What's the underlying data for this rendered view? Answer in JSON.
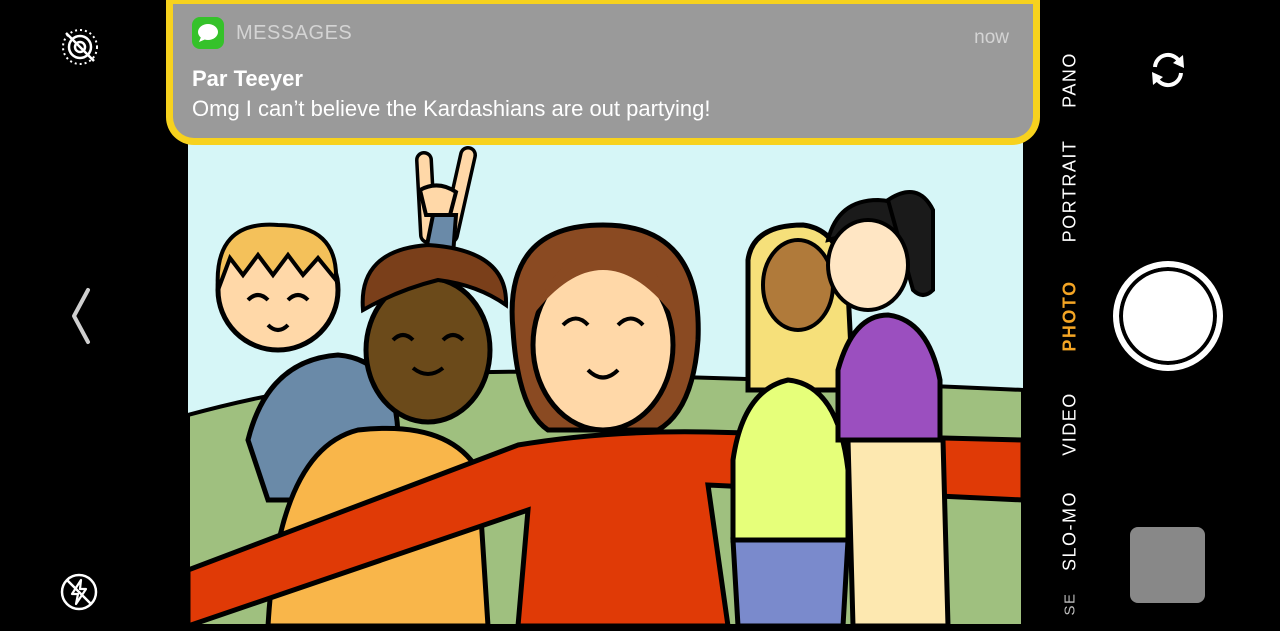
{
  "notification": {
    "app_name": "MESSAGES",
    "time": "now",
    "sender": "Par Teeyer",
    "message": "Omg I can’t believe the Kardashians are out partying!"
  },
  "camera_modes": [
    {
      "label": "PANO",
      "active": false
    },
    {
      "label": "PORTRAIT",
      "active": false
    },
    {
      "label": "PHOTO",
      "active": true
    },
    {
      "label": "VIDEO",
      "active": false
    },
    {
      "label": "SLO-MO",
      "active": false
    },
    {
      "label": "SE",
      "active": false
    }
  ],
  "icons": {
    "live_photo": "live-photo-off-icon",
    "back": "chevron-left-icon",
    "flash": "flash-off-icon",
    "flip": "flip-camera-icon",
    "messages": "messages-app-icon"
  },
  "colors": {
    "notification_border": "#f7d21e",
    "notification_bg": "#9a9a9a",
    "active_mode": "#f4a524",
    "messages_green": "#35c22a"
  }
}
